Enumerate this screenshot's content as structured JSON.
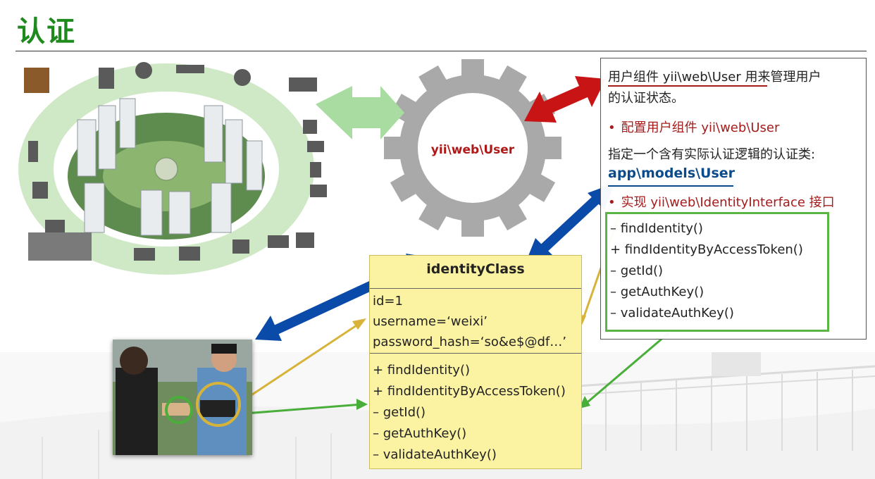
{
  "title": "认证",
  "gear": {
    "label": "yii\\web\\User"
  },
  "panel": {
    "intro_line1": "用户组件 yii\\web\\User 用来管理用户",
    "intro_line2": "的认证状态。",
    "bullet1": "配置用户组件 yii\\web\\User",
    "specify": "指定一个含有实际认证逻辑的认证类:",
    "model_class": "app\\models\\User",
    "bullet2": "实现 yii\\web\\IdentityInterface 接口",
    "methods": [
      "– findIdentity()",
      "+ findIdentityByAccessToken()",
      "– getId()",
      "– getAuthKey()",
      "– validateAuthKey()"
    ]
  },
  "identity_class": {
    "name": "identityClass",
    "attributes": [
      "id=1",
      "username=‘weixi’",
      "password_hash=‘so&e$@df…’"
    ],
    "methods": [
      "+ findIdentity()",
      "+ findIdentityByAccessToken()",
      "– getId()",
      "– getAuthKey()",
      "– validateAuthKey()"
    ]
  },
  "colors": {
    "title": "#1e8a1e",
    "red_arrow": "#c81414",
    "blue_arrow": "#0a4aa8",
    "green_arrow": "#8fd48f",
    "yellow_line": "#d8b33a",
    "green_line": "#4aae3a",
    "gear": "#a9a9a9",
    "class_fill": "#fbf3a2"
  }
}
